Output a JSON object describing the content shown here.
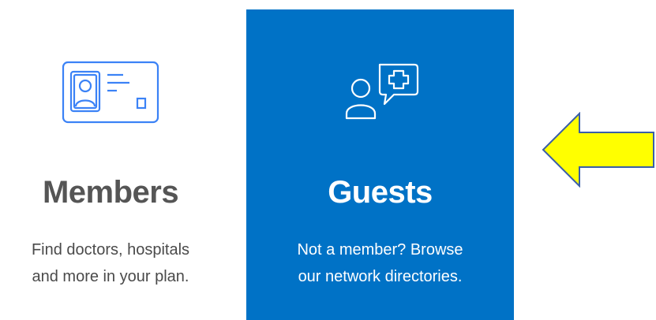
{
  "colors": {
    "accent": "#0072c6",
    "members_icon": "#3b82f6",
    "members_text": "#555555",
    "guests_text": "#ffffff",
    "arrow_fill": "#ffff00",
    "arrow_stroke": "#3a5fa8"
  },
  "cards": [
    {
      "icon": "member-id-card-icon",
      "title": "Members",
      "description_lines": [
        "Find doctors, hospitals",
        "and more in your plan."
      ]
    },
    {
      "icon": "guest-medical-chat-icon",
      "title": "Guests",
      "description_lines": [
        "Not a member? Browse",
        "our network directories."
      ]
    }
  ],
  "annotation": {
    "icon": "left-arrow-icon"
  }
}
